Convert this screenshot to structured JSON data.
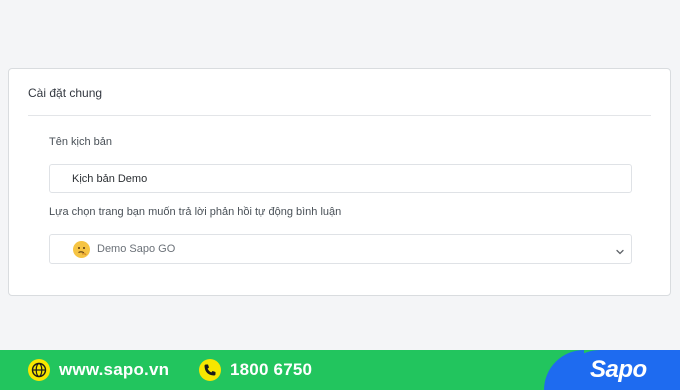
{
  "settings": {
    "title": "Cài đặt chung",
    "script_name_label": "Tên kịch bản",
    "script_name_value": "Kịch bản Demo",
    "page_select_label": "Lựa chọn trang bạn muốn trả lời phản hồi tự động bình luận",
    "page_select_value": "Demo Sapo GO",
    "page_avatar_icon": "thinking-face-icon",
    "dropdown_icon": "chevron-down-icon"
  },
  "footer": {
    "website": "www.sapo.vn",
    "website_icon": "globe-icon",
    "hotline": "1800 6750",
    "hotline_icon": "phone-icon",
    "brand": "Sapo"
  },
  "colors": {
    "background": "#f4f5f7",
    "footer_green": "#22c55e",
    "footer_blue": "#1e6bf0",
    "icon_yellow": "#f7e600"
  }
}
